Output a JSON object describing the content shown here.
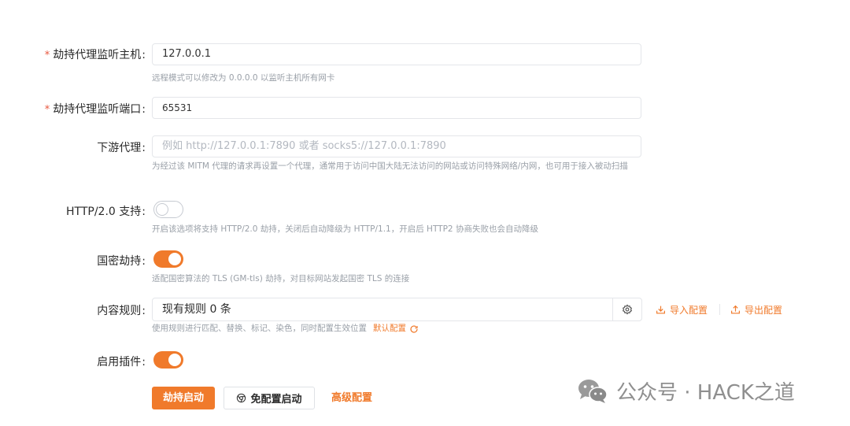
{
  "form": {
    "host": {
      "label": "劫持代理监听主机",
      "required_mark": "*",
      "colon": ":",
      "value": "127.0.0.1",
      "help": "远程模式可以修改为 0.0.0.0 以监听主机所有网卡"
    },
    "port": {
      "label": "劫持代理监听端口",
      "required_mark": "*",
      "colon": ":",
      "value": "65531"
    },
    "downstream": {
      "label": "下游代理",
      "colon": ":",
      "placeholder": "例如 http://127.0.0.1:7890 或者 socks5://127.0.0.1:7890",
      "help": "为经过该 MITM 代理的请求再设置一个代理，通常用于访问中国大陆无法访问的网站或访问特殊网络/内网，也可用于接入被动扫描"
    },
    "http2": {
      "label": "HTTP/2.0 支持",
      "colon": ":",
      "enabled": false,
      "help": "开启该选项将支持 HTTP/2.0 劫持，关闭后自动降级为 HTTP/1.1，开启后 HTTP2 协商失败也会自动降级"
    },
    "gm": {
      "label": "国密劫持",
      "colon": ":",
      "enabled": true,
      "help": "适配国密算法的 TLS (GM-tls) 劫持，对目标网站发起国密 TLS 的连接"
    },
    "rules": {
      "label": "内容规则",
      "colon": ":",
      "value": "现有规则 0 条",
      "help": "使用规则进行匹配、替换、标记、染色，同时配置生效位置",
      "default_link": "默认配置",
      "import_label": "导入配置",
      "export_label": "导出配置"
    },
    "plugins": {
      "label": "启用插件",
      "colon": ":",
      "enabled": true
    }
  },
  "actions": {
    "start_label": "劫持启动",
    "no_config_start_label": "免配置启动",
    "advanced_label": "高级配置"
  },
  "watermark": {
    "text": "公众号 · HACK之道"
  },
  "colors": {
    "accent": "#f07a2b",
    "required": "#e8573f"
  },
  "icons": {
    "gear": "gear-icon",
    "import": "import-icon",
    "export": "export-icon",
    "refresh": "refresh-icon",
    "chrome": "chrome-icon",
    "wechat": "wechat-icon"
  }
}
